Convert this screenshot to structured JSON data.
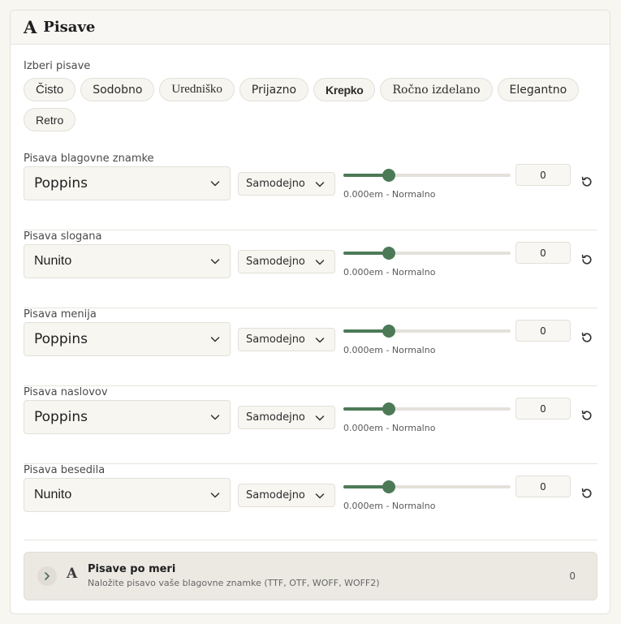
{
  "header": {
    "icon_glyph": "A",
    "icon": "font-icon",
    "title": "Pisave"
  },
  "presets": {
    "label": "Izberi pisave",
    "items": [
      "Čisto",
      "Sodobno",
      "Uredniško",
      "Prijazno",
      "Krepko",
      "Ročno izdelano",
      "Elegantno",
      "Retro"
    ]
  },
  "rows": [
    {
      "label": "Pisava blagovne znamke",
      "font": "Poppins",
      "weight": "Samodejno",
      "spacing": "0.000em - Normalno",
      "value": "0",
      "slider_fraction": 0.27
    },
    {
      "label": "Pisava slogana",
      "font": "Nunito",
      "weight": "Samodejno",
      "spacing": "0.000em - Normalno",
      "value": "0",
      "slider_fraction": 0.27
    },
    {
      "label": "Pisava menija",
      "font": "Poppins",
      "weight": "Samodejno",
      "spacing": "0.000em - Normalno",
      "value": "0",
      "slider_fraction": 0.27
    },
    {
      "label": "Pisava naslovov",
      "font": "Poppins",
      "weight": "Samodejno",
      "spacing": "0.000em - Normalno",
      "value": "0",
      "slider_fraction": 0.27
    },
    {
      "label": "Pisava besedila",
      "font": "Nunito",
      "weight": "Samodejno",
      "spacing": "0.000em - Normalno",
      "value": "0",
      "slider_fraction": 0.27
    }
  ],
  "custom": {
    "icon_glyph": "A",
    "title": "Pisave po meri",
    "subtitle": "Naložite pisavo vaše blagovne znamke (TTF, OTF, WOFF, WOFF2)",
    "count": "0"
  },
  "colors": {
    "accent": "#4c7a57",
    "track": "#e3e1da",
    "chip_bg": "#f6f5f0"
  },
  "icons": {
    "chevron": "chevron-down-icon",
    "reset": "reset-icon",
    "expand": "chevron-right-icon"
  }
}
